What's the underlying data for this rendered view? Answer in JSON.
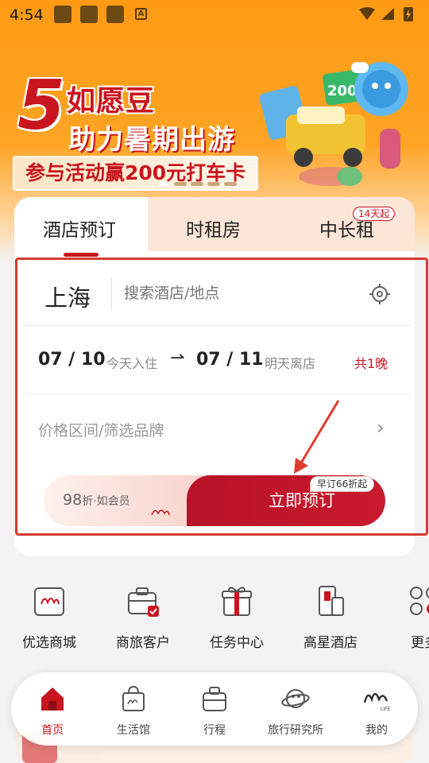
{
  "status_bar": {
    "time": "4:54"
  },
  "banner": {
    "number": "5",
    "line1": "如愿豆",
    "line2": "助力暑期出游",
    "line3": "参与活动赢200元打车卡"
  },
  "tabs": [
    {
      "label": "酒店预订",
      "active": true
    },
    {
      "label": "时租房"
    },
    {
      "label": "中长租",
      "badge": "14天起"
    }
  ],
  "search": {
    "city": "上海",
    "placeholder": "搜索酒店/地点"
  },
  "dates": {
    "checkin": "07 / 10",
    "checkin_label": "今天入住",
    "arrow": "⇀",
    "checkout": "07 / 11",
    "checkout_label": "明天离店",
    "nights": "共1晚"
  },
  "filter": {
    "label": "价格区间/筛选品牌",
    "chevron": "›"
  },
  "booking": {
    "discount": "98",
    "discount_suffix": "折·如会员",
    "button": "立即预订",
    "tag": "早订66折起"
  },
  "quick_menu": [
    {
      "label": "优选商城",
      "icon": "mall-icon"
    },
    {
      "label": "商旅客户",
      "icon": "briefcase-icon"
    },
    {
      "label": "任务中心",
      "icon": "gift-icon"
    },
    {
      "label": "高星酒店",
      "icon": "building-icon"
    },
    {
      "label": "更多",
      "icon": "more-icon"
    }
  ],
  "bottom_nav": [
    {
      "label": "首页",
      "icon": "home-icon",
      "active": true
    },
    {
      "label": "生活馆",
      "icon": "shopping-bag-icon"
    },
    {
      "label": "行程",
      "icon": "suitcase-icon"
    },
    {
      "label": "旅行研究所",
      "icon": "planet-icon"
    },
    {
      "label": "我的",
      "icon": "profile-logo-icon"
    }
  ],
  "colors": {
    "brand_red": "#c9151e",
    "orange": "#ff9a12",
    "highlight_box": "#d63a31"
  }
}
